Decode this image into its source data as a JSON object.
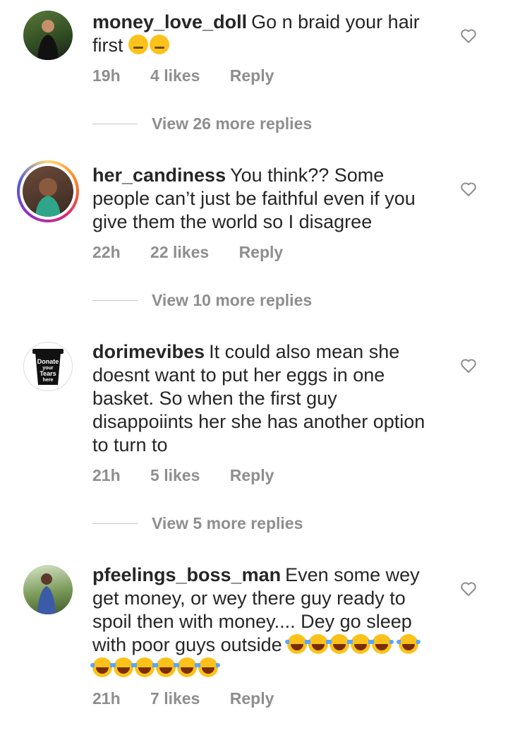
{
  "comments": [
    {
      "username": "money_love_doll",
      "text": "Go n braid your hair",
      "text2": "first",
      "time": "19h",
      "likes": "4 likes",
      "reply": "Reply",
      "view_replies": "View 26 more replies"
    },
    {
      "username": "her_candiness",
      "text": "You think?? Some people can’t just be faithful even if you give them the world so I disagree",
      "time": "22h",
      "likes": "22 likes",
      "reply": "Reply",
      "view_replies": "View 10 more replies"
    },
    {
      "username": "dorimevibes",
      "text": "It could also mean she doesnt want to put her eggs in one basket. So when the first guy disappoiints her she has another option to turn to",
      "time": "21h",
      "likes": "5 likes",
      "reply": "Reply",
      "view_replies": "View 5 more replies",
      "avatar_text": [
        "Donate",
        "your",
        "Tears",
        "here"
      ]
    },
    {
      "username": "pfeelings_boss_man",
      "text": "Even some wey get money, or wey there guy ready to spoil then with money.... Dey go sleep with poor guys outside",
      "time": "21h",
      "likes": "7 likes",
      "reply": "Reply"
    }
  ],
  "icons": {
    "like": "heart-outline-icon"
  },
  "colors": {
    "text": "#262626",
    "meta": "#8e8e8e",
    "emoji": "#fcc21b"
  }
}
